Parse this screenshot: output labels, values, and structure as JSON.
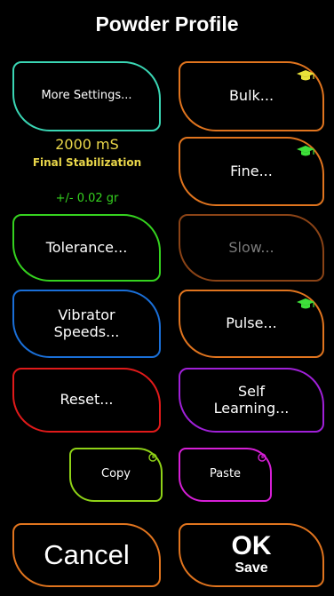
{
  "header": {
    "title": "Powder Profile"
  },
  "left": {
    "more_settings": "More Settings...",
    "stabilization_value": "2000 mS",
    "stabilization_label": "Final Stabilization",
    "tolerance_value": "+/- 0.02 gr",
    "tolerance": "Tolerance...",
    "vibrator": "Vibrator\nSpeeds...",
    "reset": "Reset...",
    "copy": "Copy"
  },
  "right": {
    "bulk": "Bulk...",
    "fine": "Fine...",
    "slow": "Slow...",
    "pulse": "Pulse...",
    "self_learning": "Self\nLearning...",
    "paste": "Paste"
  },
  "footer": {
    "cancel": "Cancel",
    "ok": "OK",
    "save": "Save"
  },
  "colors": {
    "orange": "#e0741e",
    "dim_orange": "#8a4316",
    "teal": "#3ad6b4",
    "green": "#35d21f",
    "blue": "#1a6fd8",
    "red": "#e01a1a",
    "purple": "#a020d8",
    "lime": "#8fd217",
    "magenta": "#d61fd6",
    "yellow": "#ead74a",
    "cap_yellow": "#e8e13a",
    "cap_green": "#3ee03a"
  },
  "icons": {
    "learned": "graduation-cap-icon",
    "timer": "clock-icon"
  }
}
